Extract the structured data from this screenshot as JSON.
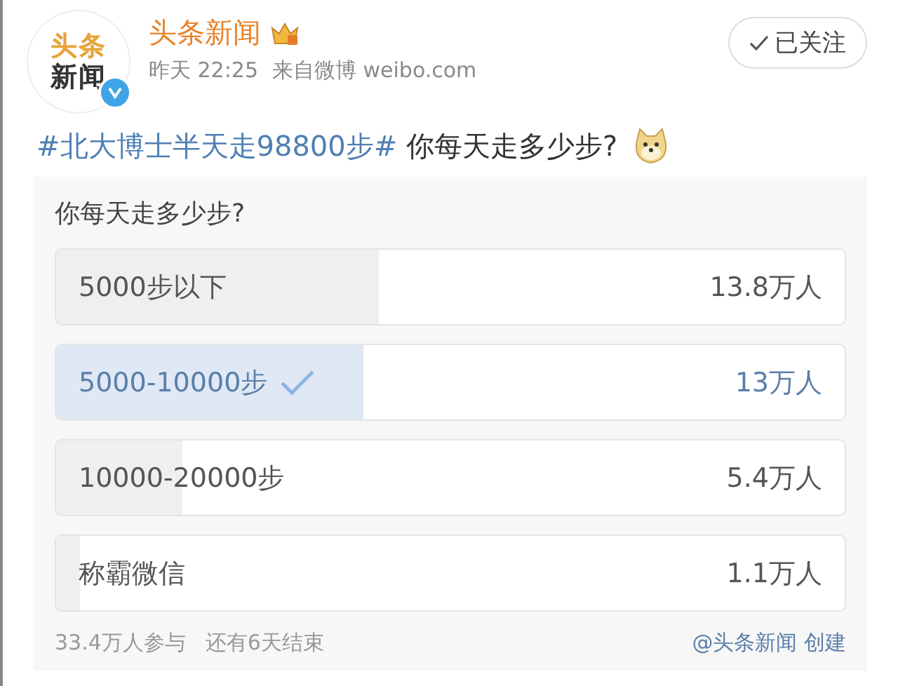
{
  "post": {
    "avatar_text": [
      "头条",
      "新闻"
    ],
    "verified": true,
    "author": "头条新闻",
    "time": "昨天 22:25",
    "source": "来自微博 weibo.com",
    "follow": {
      "label": "已关注",
      "following": true
    },
    "hashtag": "#北大博士半天走98800步#",
    "text": "你每天走多少步?"
  },
  "poll": {
    "question": "你每天走多少步?",
    "options": [
      {
        "label": "5000步以下",
        "count": "13.8万人",
        "level": 0.41,
        "selected": false
      },
      {
        "label": "5000-10000步",
        "count": "13万人",
        "level": 0.39,
        "selected": true
      },
      {
        "label": "10000-20000步",
        "count": "5.4万人",
        "level": 0.16,
        "selected": false
      },
      {
        "label": "称霸微信",
        "count": "1.1万人",
        "level": 0.03,
        "selected": false
      }
    ],
    "participants": "33.4万人参与",
    "remaining": "还有6天结束",
    "creator": "@头条新闻 创建"
  }
}
